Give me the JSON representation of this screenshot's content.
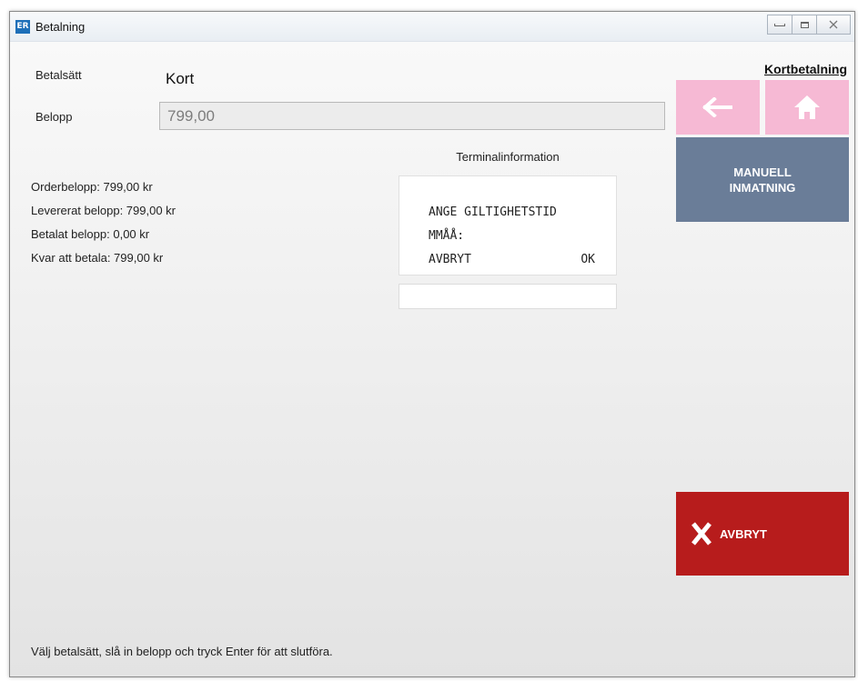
{
  "window": {
    "title": "Betalning",
    "logo_text": "ER"
  },
  "payment": {
    "method_label": "Betalsätt",
    "method_value": "Kort",
    "amount_label": "Belopp",
    "amount_value": "799,00"
  },
  "summary": {
    "order_amount": "Orderbelopp: 799,00 kr",
    "delivered_amount": "Levererat belopp: 799,00 kr",
    "paid_amount": "Betalat belopp: 0,00 kr",
    "remaining": "Kvar att betala: 799,00 kr"
  },
  "terminal": {
    "title": "Terminalinformation",
    "line1": "ANGE GILTIGHETSTID",
    "line2": "MMÅÅ:",
    "cancel_text": "AVBRYT",
    "ok_text": "OK",
    "input_value": ""
  },
  "side_panel": {
    "title": "Kortbetalning",
    "back_icon": "arrow-left-icon",
    "home_icon": "home-icon",
    "manual_label_1": "MANUELL",
    "manual_label_2": "INMATNING",
    "cancel_label": "AVBRYT",
    "cancel_icon": "x-icon"
  },
  "status": {
    "text": "Välj betalsätt, slå in belopp och tryck Enter för att slutföra."
  },
  "colors": {
    "nav_button": "#f6b9d4",
    "manual_button": "#6a7d98",
    "cancel_button": "#b71c1c"
  }
}
